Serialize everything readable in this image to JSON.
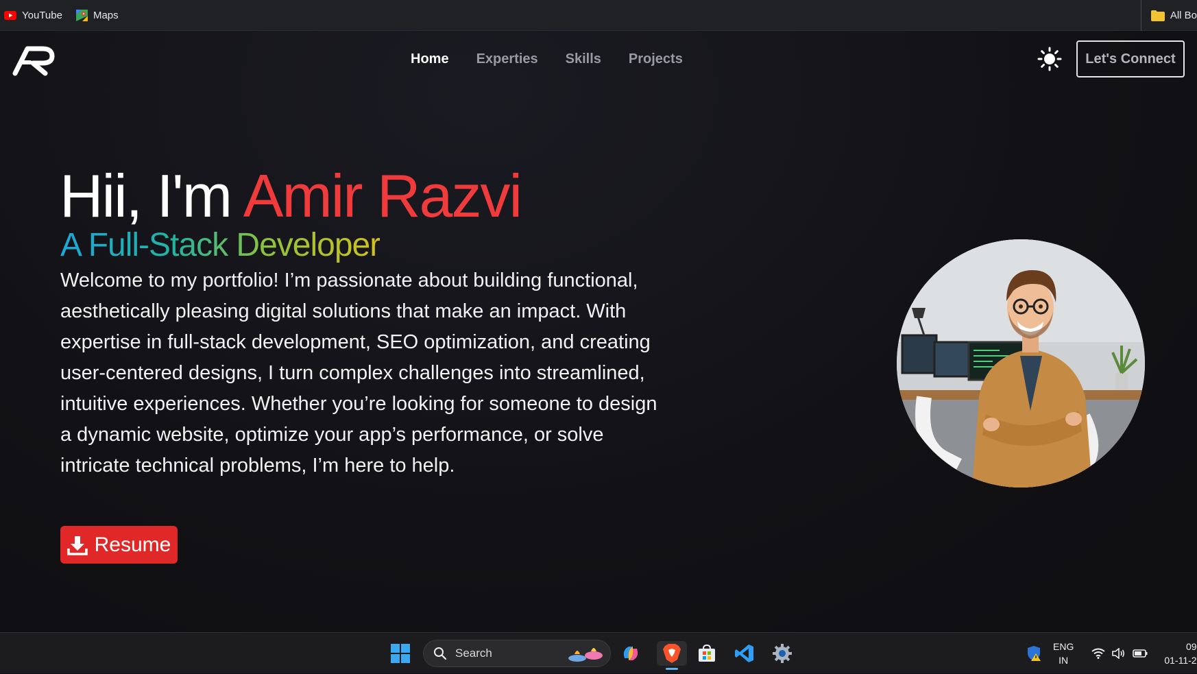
{
  "bookmarks": {
    "items": [
      {
        "label": "YouTube",
        "icon": "youtube-icon"
      },
      {
        "label": "Maps",
        "icon": "maps-icon"
      }
    ],
    "all_bookmarks_label": "All Bo"
  },
  "nav": {
    "links": [
      "Home",
      "Experties",
      "Skills",
      "Projects"
    ],
    "active": "Home",
    "connect_label": "Let's Connect",
    "theme_icon": "sun-icon"
  },
  "hero": {
    "greeting": "Hii, I'm",
    "name": "Amir Razvi",
    "subtitle": "A Full-Stack Developer",
    "description": "Welcome to my portfolio! I’m passionate about building functional, aesthetically pleasing digital solutions that make an impact. With expertise in full-stack development, SEO optimization, and creating user-centered designs, I turn complex challenges into streamlined, intuitive experiences. Whether you’re looking for someone to design a dynamic website, optimize your app’s performance, or solve intricate technical problems, I’m here to help.",
    "resume_label": "Resume"
  },
  "colors": {
    "accent": "#ef3b3b",
    "button": "#e02828",
    "background": "#121216"
  },
  "taskbar": {
    "search_placeholder": "Search",
    "language": "ENG",
    "region": "IN",
    "time": "09",
    "date": "01-11-2"
  }
}
